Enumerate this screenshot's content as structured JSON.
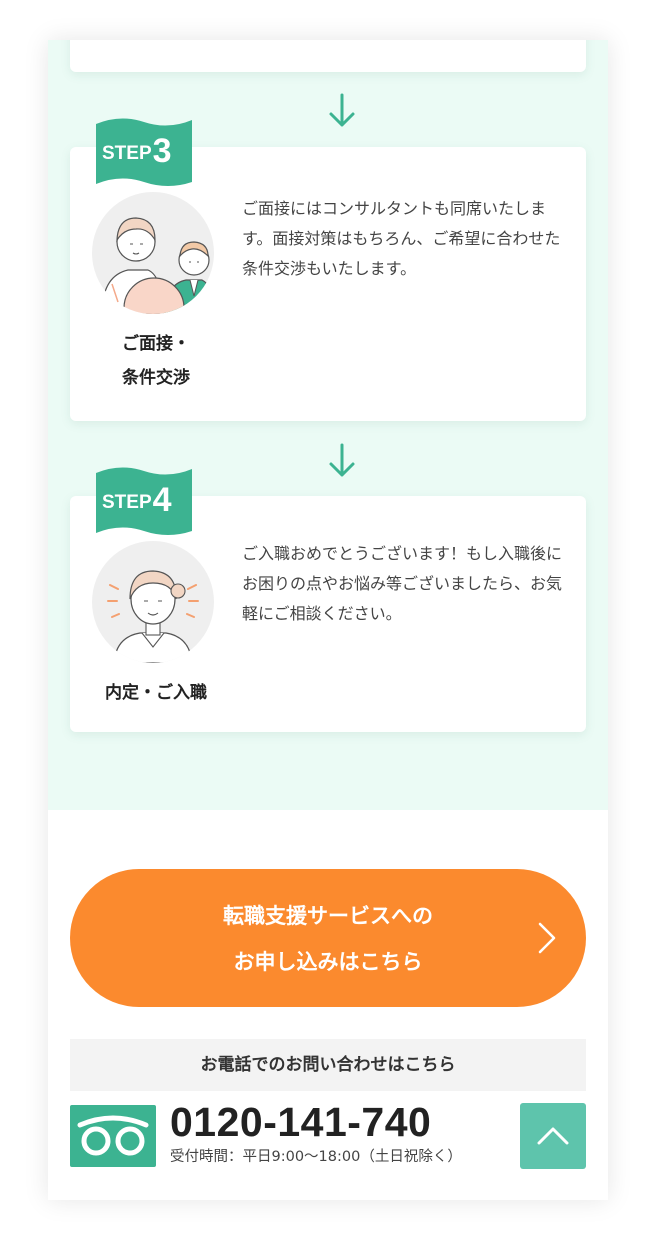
{
  "steps": [
    {
      "label": "STEP",
      "number": "3",
      "title_lines": [
        "ご面接・",
        "条件交渉"
      ],
      "description": "ご面接にはコンサルタントも同席いたします。面接対策はもちろん、ご希望に合わせた条件交渉もいたします。",
      "illustration": "interview-illustration"
    },
    {
      "label": "STEP",
      "number": "4",
      "title_lines": [
        "内定・ご入職"
      ],
      "description": "ご入職おめでとうございます！もし入職後にお困りの点やお悩み等ございましたら、お気軽にご相談ください。",
      "illustration": "hired-woman-illustration"
    }
  ],
  "cta": {
    "line1": "転職支援サービスへの",
    "line2": "お申し込みはこちら",
    "icon": "chevron-right-icon"
  },
  "contact": {
    "heading": "お電話でのお問い合わせはこちら",
    "phone": "0120-141-740",
    "hours": "受付時間：平日9:00〜18:00（土日祝除く）",
    "icon": "freedial-icon"
  },
  "back_to_top": {
    "icon": "chevron-up-icon"
  },
  "colors": {
    "accent_green": "#3cb391",
    "mint_background": "#ebfbf5",
    "cta_orange": "#fb8a2e",
    "totop_green": "#5ec4ac"
  }
}
